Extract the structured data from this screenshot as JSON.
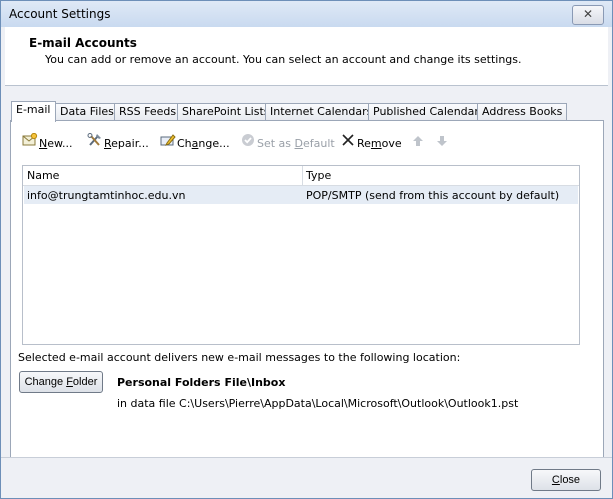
{
  "window": {
    "title": "Account Settings",
    "close_glyph": "✕"
  },
  "header": {
    "title": "E-mail Accounts",
    "subtitle": "You can add or remove an account. You can select an account and change its settings."
  },
  "tabs": [
    {
      "label": "E-mail",
      "active": true
    },
    {
      "label": "Data Files"
    },
    {
      "label": "RSS Feeds"
    },
    {
      "label": "SharePoint Lists"
    },
    {
      "label": "Internet Calendars"
    },
    {
      "label": "Published Calendars"
    },
    {
      "label": "Address Books"
    }
  ],
  "toolbar": {
    "new": {
      "pre": "",
      "key": "N",
      "post": "ew..."
    },
    "repair": {
      "pre": "",
      "key": "R",
      "post": "epair..."
    },
    "change": {
      "pre": "Ch",
      "key": "a",
      "post": "nge..."
    },
    "default": {
      "pre": "Set as ",
      "key": "D",
      "post": "efault"
    },
    "remove": {
      "pre": "Re",
      "key": "m",
      "post": "ove"
    }
  },
  "list": {
    "columns": [
      "Name",
      "Type"
    ],
    "rows": [
      {
        "name": "info@trungtamtinhoc.edu.vn",
        "type": "POP/SMTP (send from this account by default)"
      }
    ]
  },
  "delivery": {
    "note": "Selected e-mail account delivers new e-mail messages to the following location:",
    "button": {
      "pre": "Change ",
      "key": "F",
      "post": "older"
    },
    "folder": "Personal Folders File\\Inbox",
    "path": "in data file C:\\Users\\Pierre\\AppData\\Local\\Microsoft\\Outlook\\Outlook1.pst"
  },
  "footer": {
    "close": {
      "pre": "",
      "key": "C",
      "post": "lose"
    }
  }
}
